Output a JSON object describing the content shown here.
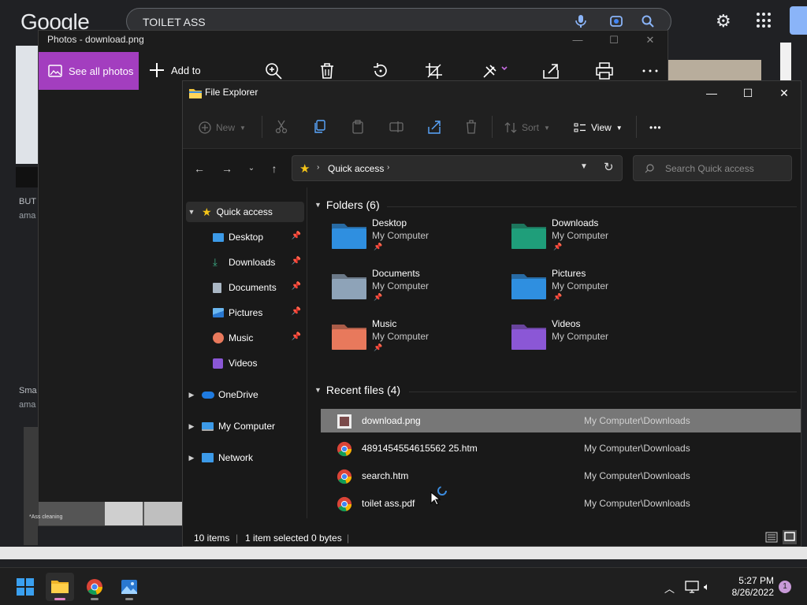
{
  "google": {
    "logo": "Google",
    "query": "TOILET ASS",
    "results_tag_1": "BUT",
    "results_sub_1": "ama",
    "results_tag_2": "Sma",
    "results_sub_2": "ama",
    "thumb_caption": "*Ass cleaning"
  },
  "photos": {
    "title": "Photos - download.png",
    "see_all": "See all photos",
    "add_to": "Add to"
  },
  "explorer": {
    "title": "File Explorer",
    "cmd": {
      "new": "New",
      "sort": "Sort",
      "view": "View",
      "more": "•••"
    },
    "address": "Quick access",
    "search_placeholder": "Search Quick access",
    "nav": {
      "quick_access": "Quick access",
      "items": [
        "Desktop",
        "Downloads",
        "Documents",
        "Pictures",
        "Music",
        "Videos"
      ],
      "onedrive": "OneDrive",
      "my_computer": "My Computer",
      "network": "Network"
    },
    "folders_header": "Folders (6)",
    "folders": [
      {
        "name": "Desktop",
        "location": "My Computer",
        "pinned": true,
        "color": "#2f8fe0"
      },
      {
        "name": "Downloads",
        "location": "My Computer",
        "pinned": true,
        "color": "#1f9e7a"
      },
      {
        "name": "Documents",
        "location": "My Computer",
        "pinned": true,
        "color": "#8ea3b8"
      },
      {
        "name": "Pictures",
        "location": "My Computer",
        "pinned": true,
        "color": "#2f8fe0"
      },
      {
        "name": "Music",
        "location": "My Computer",
        "pinned": true,
        "color": "#e8795c"
      },
      {
        "name": "Videos",
        "location": "My Computer",
        "pinned": false,
        "color": "#8b57d6"
      }
    ],
    "recent_header": "Recent files (4)",
    "recent": [
      {
        "name": "download.png",
        "path": "My Computer\\Downloads",
        "icon": "image-file-icon"
      },
      {
        "name": "4891454554615562 25.htm",
        "path": "My Computer\\Downloads",
        "icon": "chrome-icon"
      },
      {
        "name": "search.htm",
        "path": "My Computer\\Downloads",
        "icon": "chrome-icon"
      },
      {
        "name": "toilet ass.pdf",
        "path": "My Computer\\Downloads",
        "icon": "chrome-icon"
      }
    ],
    "status": {
      "items": "10 items",
      "selected": "1 item selected",
      "size": "0 bytes"
    }
  },
  "taskbar": {
    "time": "5:27 PM",
    "date": "8/26/2022",
    "badge": "1"
  }
}
